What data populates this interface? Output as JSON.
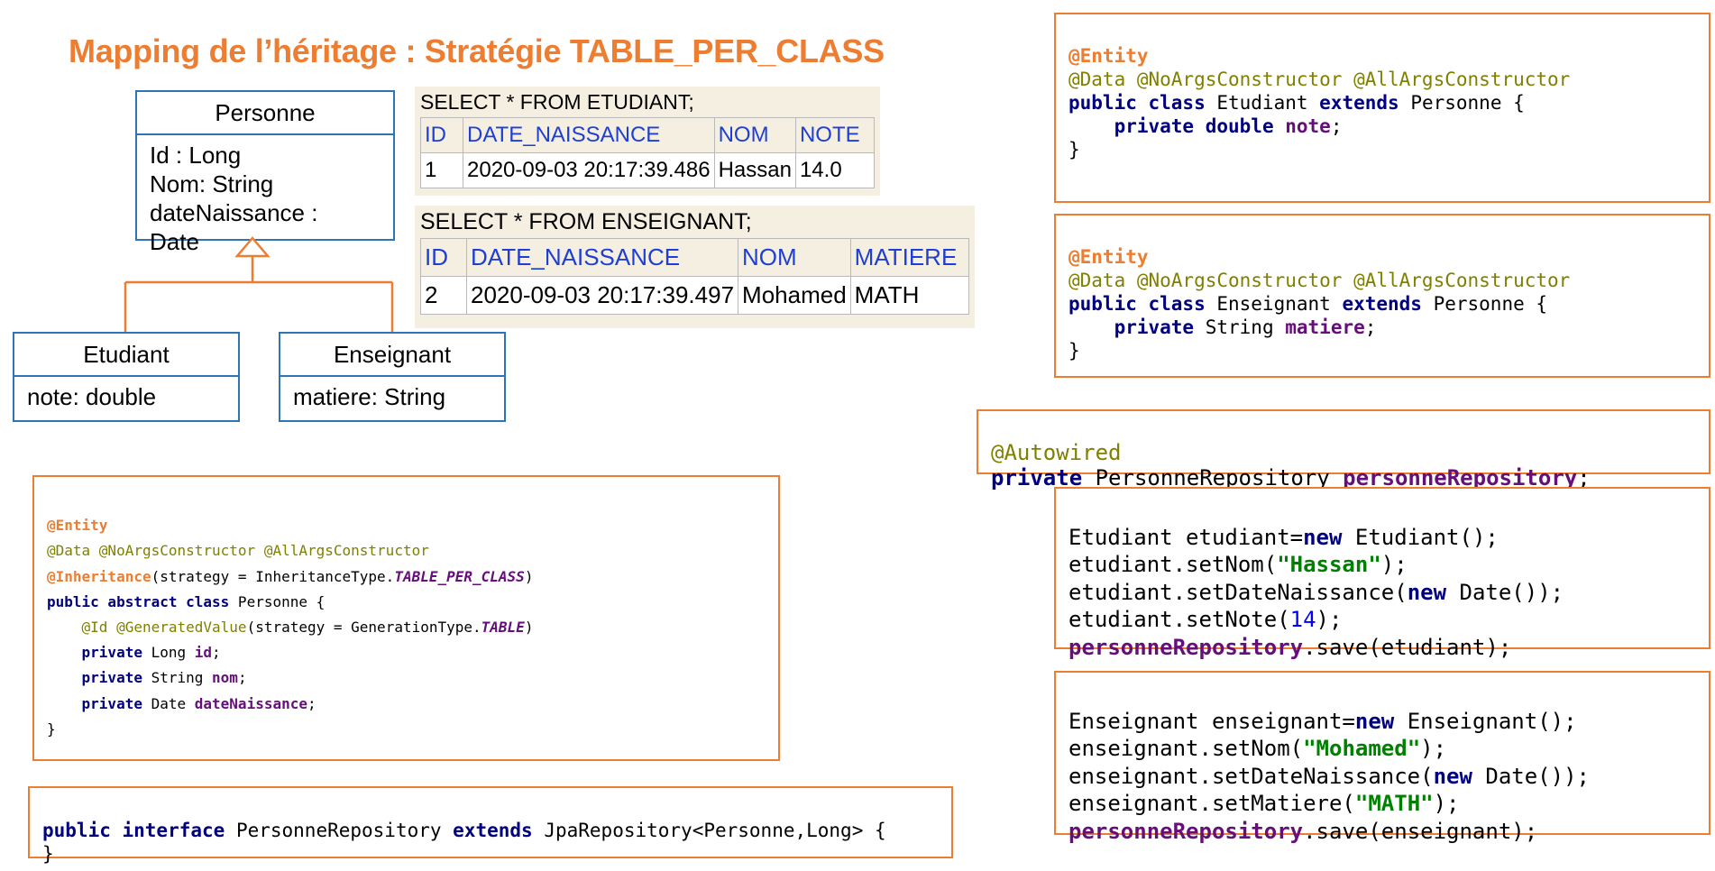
{
  "title": "Mapping de l’héritage : Stratégie TABLE_PER_CLASS",
  "uml": {
    "personne": {
      "name": "Personne",
      "attrs": [
        "Id : Long",
        "Nom: String",
        "dateNaissance :",
        "Date"
      ]
    },
    "etudiant": {
      "name": "Etudiant",
      "attr": "note: double"
    },
    "enseignant": {
      "name": "Enseignant",
      "attr": "matiere: String"
    }
  },
  "sql_etudiant": {
    "query": "SELECT * FROM ETUDIANT;",
    "headers": [
      "ID",
      "DATE_NAISSANCE",
      "NOM",
      "NOTE"
    ],
    "row": [
      "1",
      "2020-09-03 20:17:39.486",
      "Hassan",
      "14.0"
    ]
  },
  "sql_enseignant": {
    "query": "SELECT * FROM ENSEIGNANT;",
    "headers": [
      "ID",
      "DATE_NAISSANCE",
      "NOM",
      "MATIERE"
    ],
    "row": [
      "2",
      "2020-09-03 20:17:39.497",
      "Mohamed",
      "MATH"
    ]
  },
  "code_personne": {
    "entity": "@Entity",
    "data_ann": "@Data @NoArgsConstructor @AllArgsConstructor",
    "inh_ann": "@Inheritance",
    "inh_mid": "(strategy = InheritanceType.",
    "inh_val": "TABLE_PER_CLASS",
    "inh_end": ")",
    "class_kw": "public abstract class",
    "class_rest": " Personne {",
    "id_ann": "@Id @GeneratedValue",
    "id_mid": "(strategy = GenerationType.",
    "id_val": "TABLE",
    "id_end": ")",
    "private": "private",
    "f1_type": " Long ",
    "f1_name": "id",
    "f2_type": " String ",
    "f2_name": "nom",
    "f3_type": " Date ",
    "f3_name": "dateNaissance",
    "semi": ";",
    "close": "}"
  },
  "code_repo": {
    "kw1": "public interface",
    "name": " PersonneRepository ",
    "kw2": "extends",
    "rest": " JpaRepository<Personne,Long> {",
    "close": "}"
  },
  "code_etudiant": {
    "entity": "@Entity",
    "data_ann": "@Data @NoArgsConstructor @AllArgsConstructor",
    "kw1": "public class",
    "name": " Etudiant ",
    "kw2": "extends",
    "rest": " Personne {",
    "indent": "    ",
    "priv": "private double",
    "field": "note",
    "semi": ";",
    "close": "}"
  },
  "code_enseignant": {
    "entity": "@Entity",
    "data_ann": "@Data @NoArgsConstructor @AllArgsConstructor",
    "kw1": "public class",
    "name": " Enseignant ",
    "kw2": "extends",
    "rest": " Personne {",
    "indent": "    ",
    "priv": "private",
    "type": " String ",
    "field": "matiere",
    "semi": ";",
    "close": "}"
  },
  "code_autowired": {
    "ann": "@Autowired",
    "priv": "private",
    "type": " PersonneRepository ",
    "field": "personneRepository",
    "semi": ";"
  },
  "code_save_etudiant": {
    "l1a": "Etudiant etudiant=",
    "l1kw": "new",
    "l1b": " Etudiant();",
    "l2a": "etudiant.setNom(",
    "l2s": "\"Hassan\"",
    "l2b": ");",
    "l3a": "etudiant.setDateNaissance(",
    "l3kw": "new",
    "l3b": " Date());",
    "l4a": "etudiant.setNote(",
    "l4n": "14",
    "l4b": ");",
    "l5f": "personneRepository",
    "l5b": ".save(etudiant);"
  },
  "code_save_enseignant": {
    "l1a": "Enseignant enseignant=",
    "l1kw": "new",
    "l1b": " Enseignant();",
    "l2a": "enseignant.setNom(",
    "l2s": "\"Mohamed\"",
    "l2b": ");",
    "l3a": "enseignant.setDateNaissance(",
    "l3kw": "new",
    "l3b": " Date());",
    "l4a": "enseignant.setMatiere(",
    "l4s": "\"MATH\"",
    "l4b": ");",
    "l5f": "personneRepository",
    "l5b": ".save(enseignant);"
  }
}
